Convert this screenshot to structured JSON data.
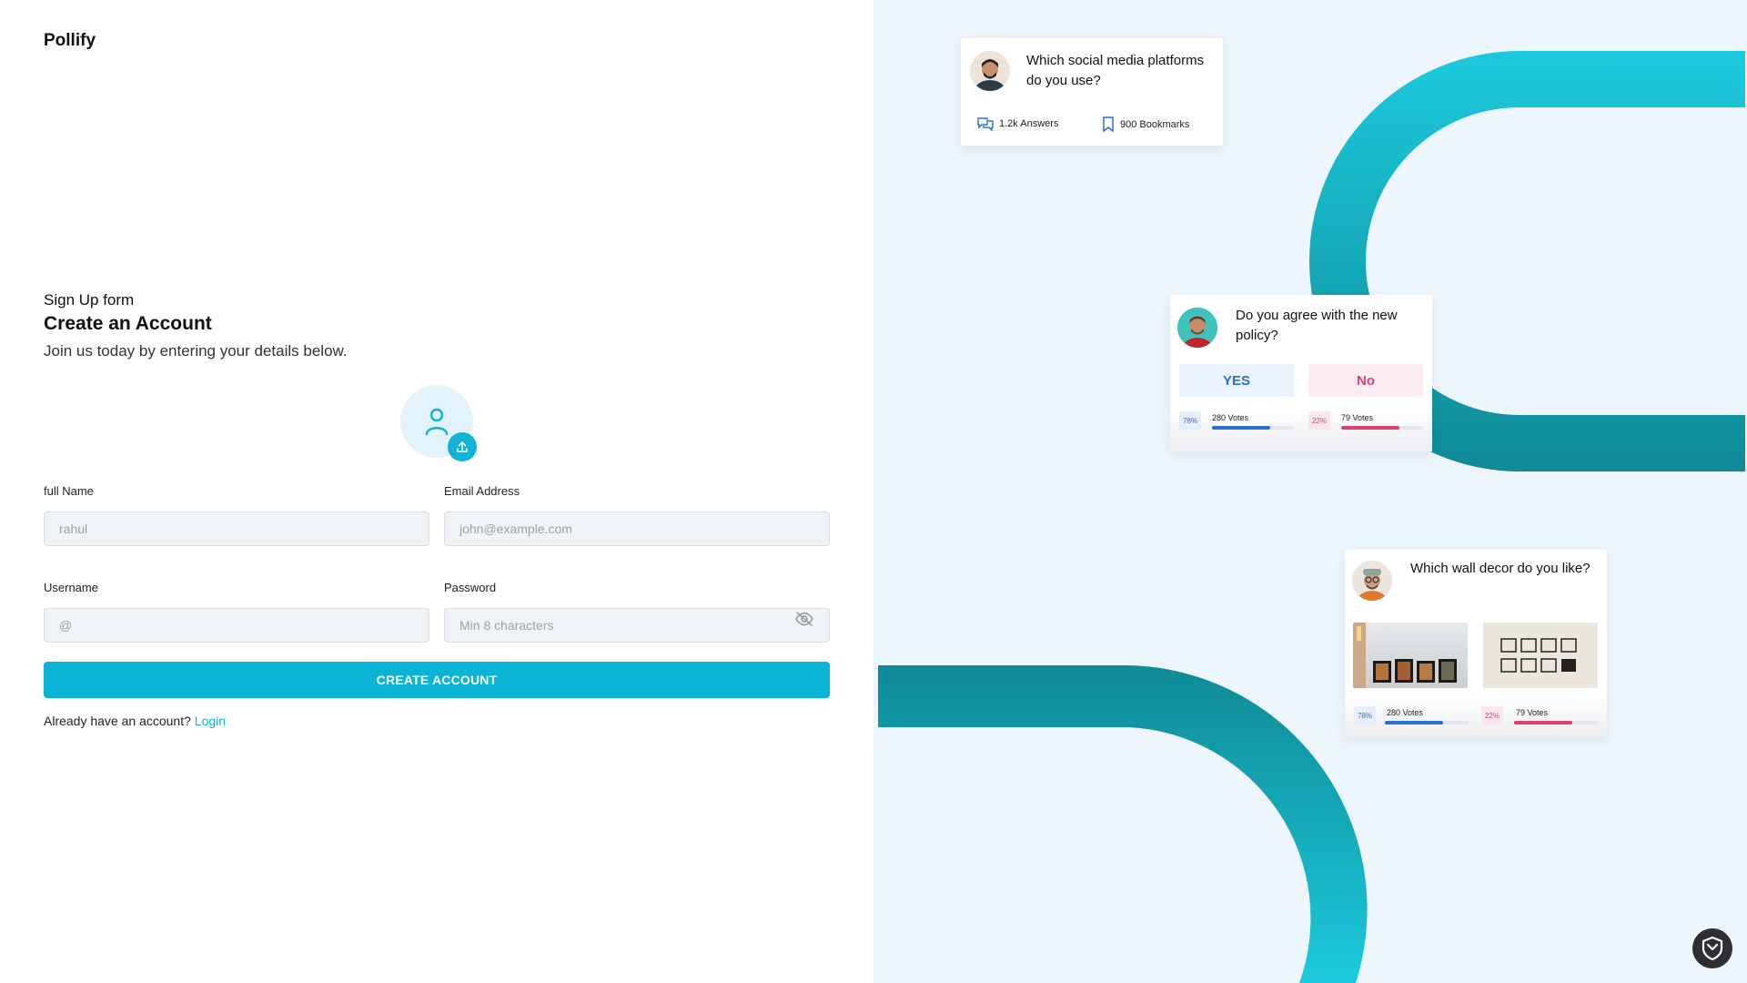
{
  "brand": "Pollify",
  "form": {
    "kicker": "Sign Up form",
    "title": "Create an Account",
    "description": "Join us today by entering your details below.",
    "full_name_label": "full Name",
    "full_name_placeholder": "rahul",
    "email_label": "Email Address",
    "email_placeholder": "john@example.com",
    "username_label": "Username",
    "username_placeholder": "@",
    "password_label": "Password",
    "password_placeholder": "Min 8 characters",
    "submit_label": "CREATE ACCOUNT",
    "login_prompt": "Already have an account?",
    "login_link": "Login"
  },
  "cards": {
    "social": {
      "question": "Which social media platforms do you use?",
      "answers": "1.2k Answers",
      "bookmarks": "900 Bookmarks"
    },
    "policy": {
      "question": "Do you agree with the new policy?",
      "yes_label": "YES",
      "no_label": "No",
      "yes_pct": "78%",
      "yes_votes": "280 Votes",
      "yes_fraction": 0.78,
      "no_pct": "22%",
      "no_votes": "79 Votes",
      "no_fraction": 0.22
    },
    "decor": {
      "question": "Which wall decor do you like?",
      "left_pct": "78%",
      "left_votes": "280 Votes",
      "right_pct": "22%",
      "right_votes": "79 Votes"
    }
  },
  "colors": {
    "accent": "#0ab4d6",
    "panel_bg": "#eef6fd",
    "yes_blue": "#2a6fd6",
    "no_red": "#e0426b",
    "arc_teal_light": "#1ccadd",
    "arc_teal_dark": "#0f8a96"
  }
}
